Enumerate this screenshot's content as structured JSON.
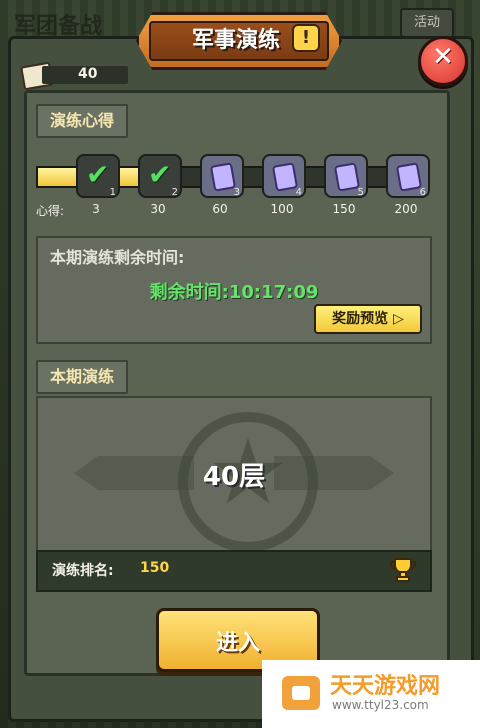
{
  "background": {
    "left_text": "军团备战",
    "right_tab_label": "活动"
  },
  "header": {
    "title": "军事演练"
  },
  "resources": {
    "book_count": "40"
  },
  "sections": {
    "progress_title": "演练心得",
    "current_title": "本期演练"
  },
  "progress": {
    "label": "心得:",
    "fill_fraction": 0.34,
    "nodes": [
      {
        "index": "1",
        "value": "3",
        "state": "claimed"
      },
      {
        "index": "2",
        "value": "30",
        "state": "claimed"
      },
      {
        "index": "3",
        "value": "60",
        "state": "locked"
      },
      {
        "index": "4",
        "value": "100",
        "state": "locked"
      },
      {
        "index": "5",
        "value": "150",
        "state": "locked"
      },
      {
        "index": "6",
        "value": "200",
        "state": "locked"
      }
    ]
  },
  "timer": {
    "title": "本期演练剩余时间:",
    "remaining": "剩余时间:10:17:09",
    "preview_button": "奖励预览"
  },
  "drill": {
    "layer": "40层",
    "rank_label": "演练排名:",
    "rank_value": "150"
  },
  "actions": {
    "enter": "进入"
  },
  "watermark": {
    "brand": "天天游戏网",
    "url": "www.ttyl23.com"
  },
  "colors": {
    "progress_green": "#55e064",
    "gold": "#f3c93b",
    "danger": "#d8352e"
  }
}
